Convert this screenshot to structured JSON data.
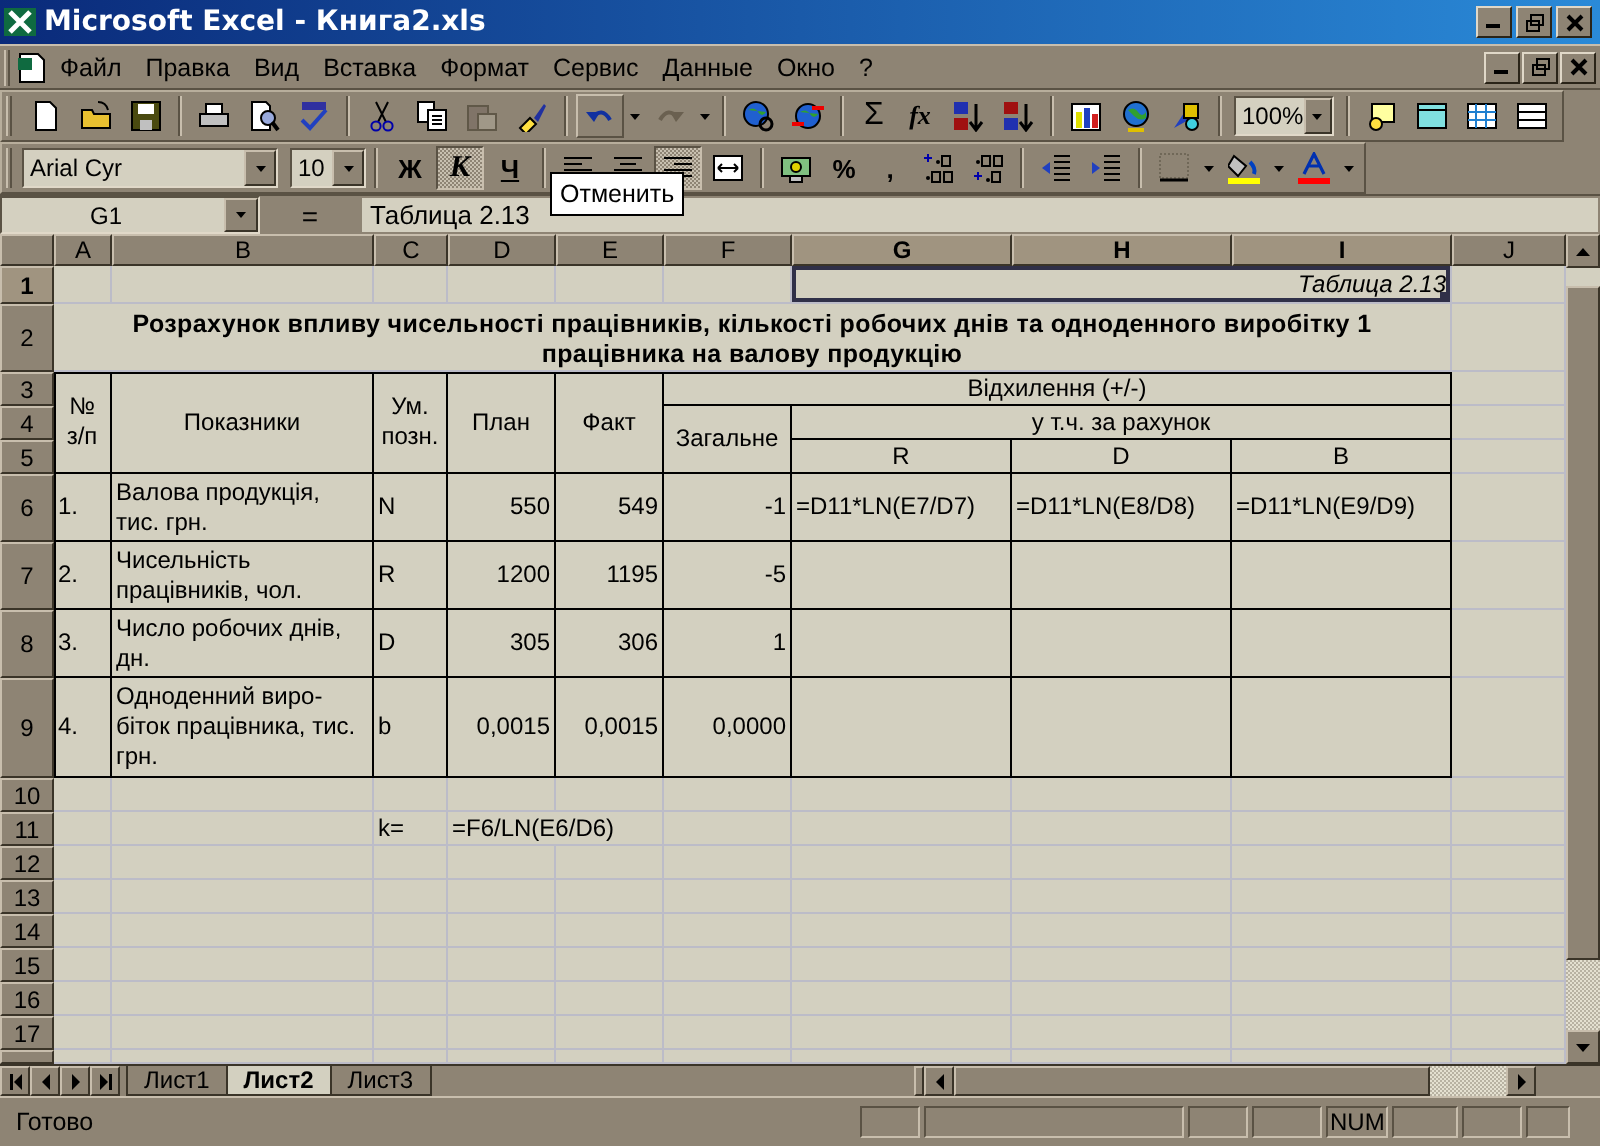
{
  "window": {
    "title": "Microsoft Excel - Книга2.xls"
  },
  "menu": [
    "Файл",
    "Правка",
    "Вид",
    "Вставка",
    "Формат",
    "Сервис",
    "Данные",
    "Окно",
    "?"
  ],
  "standard_toolbar": {
    "sum": "Σ",
    "function": "fx",
    "zoom": "100%"
  },
  "formatting_toolbar": {
    "font": "Arial Cyr",
    "size": "10",
    "styles": [
      {
        "label": "Ж",
        "pressed": false
      },
      {
        "label": "К",
        "pressed": true
      },
      {
        "label": "Ч",
        "pressed": false
      }
    ],
    "alignment": [
      {
        "kind": "left",
        "pressed": false
      },
      {
        "kind": "center",
        "pressed": false
      },
      {
        "kind": "right",
        "pressed": true
      },
      {
        "kind": "merge",
        "pressed": false
      }
    ],
    "number_formats": [
      "%",
      ","
    ]
  },
  "tooltip": "Отменить",
  "formula_bar": {
    "name_box": "G1",
    "equals": "=",
    "formula": "Таблица 2.13"
  },
  "sheet": {
    "columns": [
      "A",
      "B",
      "C",
      "D",
      "E",
      "F",
      "G",
      "H",
      "I",
      "J"
    ],
    "rows": [
      "1",
      "2",
      "3",
      "4",
      "5",
      "6",
      "7",
      "8",
      "9",
      "10",
      "11",
      "12",
      "13",
      "14",
      "15",
      "16",
      "17"
    ],
    "cells": [
      {
        "text": "Таблица 2.13",
        "kind": "caption",
        "selected": true
      },
      {
        "text": "Розрахунок впливу чисельності працівників, кількості робочих днів та одноденного виробітку 1 працівника на валову продукцію",
        "kind": "title",
        "selected": false
      },
      {
        "text": "№ з/п",
        "kind": "header",
        "selected": false
      },
      {
        "text": "Показники",
        "kind": "header",
        "selected": false
      },
      {
        "text": "Ум. позн.",
        "kind": "header",
        "selected": false
      },
      {
        "text": "План",
        "kind": "header",
        "selected": false
      },
      {
        "text": "Факт",
        "kind": "header",
        "selected": false
      },
      {
        "text": "Відхилення (+/-)",
        "kind": "header",
        "selected": false
      },
      {
        "text": "Загальне",
        "kind": "header",
        "selected": false
      },
      {
        "text": "у т.ч. за рахунок",
        "kind": "header",
        "selected": false
      },
      {
        "text": "R",
        "kind": "header",
        "selected": false
      },
      {
        "text": "D",
        "kind": "header",
        "selected": false
      },
      {
        "text": "B",
        "kind": "header",
        "selected": false
      },
      {
        "text": "1.",
        "kind": "text",
        "selected": false
      },
      {
        "text": "Валова продукція, тис. грн.",
        "kind": "text",
        "selected": false
      },
      {
        "text": "N",
        "kind": "text",
        "selected": false
      },
      {
        "text": "550",
        "kind": "number",
        "selected": false
      },
      {
        "text": "549",
        "kind": "number",
        "selected": false
      },
      {
        "text": "-1",
        "kind": "number",
        "selected": false
      },
      {
        "text": "=D11*LN(E7/D7)",
        "kind": "text",
        "selected": false
      },
      {
        "text": "=D11*LN(E8/D8)",
        "kind": "text",
        "selected": false
      },
      {
        "text": "=D11*LN(E9/D9)",
        "kind": "text",
        "selected": false
      },
      {
        "text": "2.",
        "kind": "text",
        "selected": false
      },
      {
        "text": "Чисельність працівників, чол.",
        "kind": "text",
        "selected": false
      },
      {
        "text": "R",
        "kind": "text",
        "selected": false
      },
      {
        "text": "1200",
        "kind": "number",
        "selected": false
      },
      {
        "text": "1195",
        "kind": "number",
        "selected": false
      },
      {
        "text": "-5",
        "kind": "number",
        "selected": false
      },
      {
        "text": "3.",
        "kind": "text",
        "selected": false
      },
      {
        "text": "Число робочих днів, дн.",
        "kind": "text",
        "selected": false
      },
      {
        "text": "D",
        "kind": "text",
        "selected": false
      },
      {
        "text": "305",
        "kind": "number",
        "selected": false
      },
      {
        "text": "306",
        "kind": "number",
        "selected": false
      },
      {
        "text": "1",
        "kind": "number",
        "selected": false
      },
      {
        "text": "4.",
        "kind": "text",
        "selected": false
      },
      {
        "text": "Одноденний виро-біток працівника, тис. грн.",
        "kind": "text",
        "selected": false
      },
      {
        "text": "b",
        "kind": "text",
        "selected": false
      },
      {
        "text": "0,0015",
        "kind": "number",
        "selected": false
      },
      {
        "text": "0,0015",
        "kind": "number",
        "selected": false
      },
      {
        "text": "0,0000",
        "kind": "number",
        "selected": false
      },
      {
        "text": "k=",
        "kind": "text",
        "selected": false
      },
      {
        "text": "=F6/LN(E6/D6)",
        "kind": "text",
        "selected": false
      }
    ]
  },
  "sheet_tabs": [
    {
      "label": "Лист1",
      "selected": false
    },
    {
      "label": "Лист2",
      "selected": true
    },
    {
      "label": "Лист3",
      "selected": false
    }
  ],
  "status_bar": {
    "text": "Готово",
    "indicators": [
      "NUM"
    ]
  }
}
